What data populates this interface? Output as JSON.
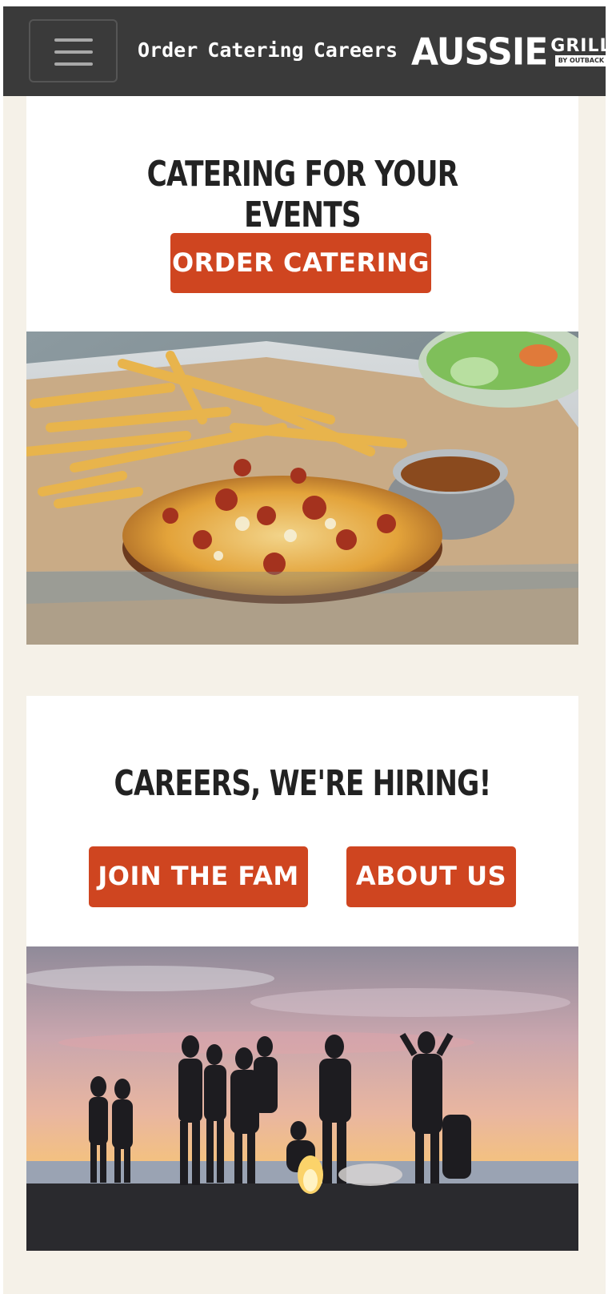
{
  "header": {
    "menu_icon": "hamburger-icon",
    "nav": [
      "Order",
      "Catering",
      "Careers"
    ],
    "logo": {
      "main": "AUSSIE",
      "side": "GRILL",
      "tag": "BY OUTBACK"
    }
  },
  "catering": {
    "title": "CATERING FOR YOUR EVENTS",
    "button": "ORDER CATERING"
  },
  "careers": {
    "title": "CAREERS, WE'RE HIRING!",
    "buttons": [
      "JOIN THE FAM",
      "ABOUT US"
    ]
  },
  "colors": {
    "accent": "#cf4520",
    "header_bg": "#3a3a3a",
    "page_bg": "#f5f1e8"
  }
}
